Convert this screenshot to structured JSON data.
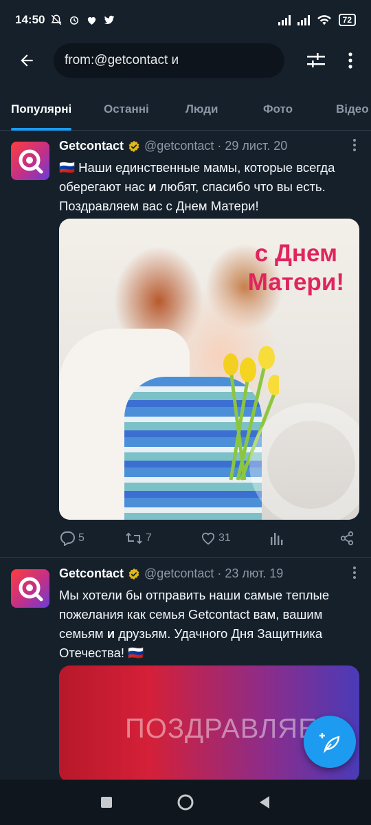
{
  "status_bar": {
    "time": "14:50",
    "battery": "72"
  },
  "search": {
    "query": "from:@getcontact и"
  },
  "tabs": [
    "Популярні",
    "Останні",
    "Люди",
    "Фото",
    "Відео"
  ],
  "tweets": [
    {
      "name": "Getcontact",
      "handle": "@getcontact",
      "date": "· 29 лист. 20",
      "flag": "🇷🇺",
      "text_before": " Наши единственные мамы, которые всегда оберегают нас ",
      "bold": "и",
      "text_after": " любят, спасибо что вы есть. Поздравляем вас с Днем Матери!",
      "media_caption_line1": "с Днем",
      "media_caption_line2": "Матери!",
      "replies": "5",
      "retweets": "7",
      "likes": "31"
    },
    {
      "name": "Getcontact",
      "handle": "@getcontact",
      "date": "· 23 лют. 19",
      "flag": "🇷🇺",
      "text_before": "Мы хотели бы отправить наши самые теплые пожелания как семья Getcontact вам, вашим семьям ",
      "bold": "и",
      "text_after": " друзьям. Удачного Дня Защитника Отечества! ",
      "media_caption": "ПОЗДРАВЛЯЕМ"
    }
  ],
  "colors": {
    "accent": "#1d9bf0",
    "background": "#15202b",
    "verified": "#e2b719"
  }
}
